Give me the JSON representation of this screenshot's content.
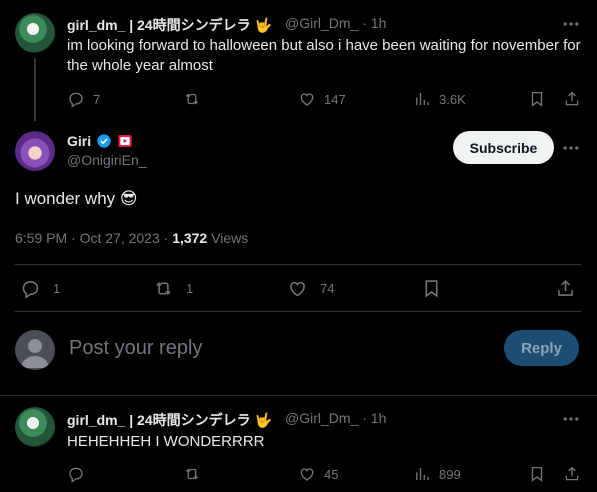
{
  "parent_tweet": {
    "name": "girl_dm_ | 24時間シンデレラ 🤟",
    "handle": "@Girl_Dm_",
    "time": "· 1h",
    "text": "im looking forward to halloween but also i have been waiting for november for the whole year almost",
    "replies": "7",
    "likes": "147",
    "views": "3.6K"
  },
  "main_tweet": {
    "name": "Giri",
    "handle": "@OnigiriEn_",
    "subscribe_label": "Subscribe",
    "text": "I wonder why 😎",
    "timestamp": "6:59 PM · Oct 27, 2023 · ",
    "view_count": "1,372",
    "view_label": " Views",
    "replies": "1",
    "reposts": "1",
    "likes": "74"
  },
  "composer": {
    "placeholder": "Post your reply",
    "reply_label": "Reply"
  },
  "reply_tweet": {
    "name": "girl_dm_ | 24時間シンデレラ 🤟",
    "handle": "@Girl_Dm_",
    "time": "· 1h",
    "text": "HEHEHHEH I WONDERRRR",
    "likes": "45",
    "views": "899"
  },
  "colors": {
    "background": "#000000",
    "text": "#e7e9ea",
    "muted": "#71767b",
    "verified": "#1d9bf0",
    "reply_button": "#1d4d73"
  }
}
